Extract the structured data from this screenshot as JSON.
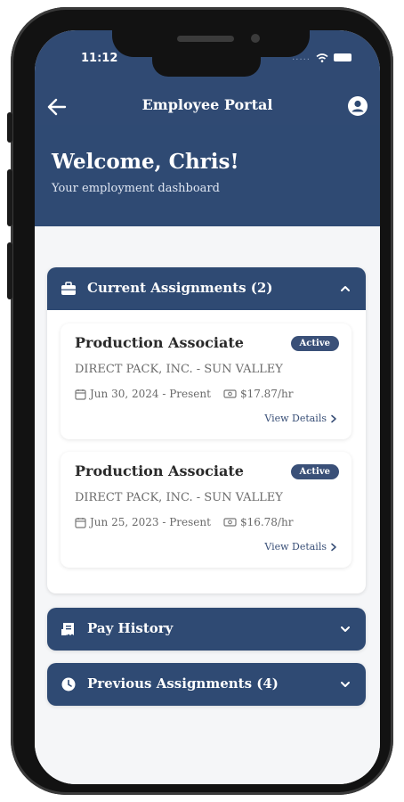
{
  "status_bar": {
    "time": "11:12",
    "signal_dots": "....."
  },
  "nav": {
    "title": "Employee Portal"
  },
  "welcome": {
    "title": "Welcome, Chris!",
    "subtitle": "Your employment dashboard"
  },
  "sections": {
    "current": {
      "title": "Current Assignments (2)",
      "assignments": [
        {
          "title": "Production Associate",
          "status": "Active",
          "company": "DIRECT PACK, INC. - SUN VALLEY",
          "dates": "Jun 30, 2024 - Present",
          "pay": "$17.87/hr",
          "link": "View Details"
        },
        {
          "title": "Production Associate",
          "status": "Active",
          "company": "DIRECT PACK, INC. - SUN VALLEY",
          "dates": "Jun 25, 2023 - Present",
          "pay": "$16.78/hr",
          "link": "View Details"
        }
      ]
    },
    "pay_history": {
      "title": "Pay History"
    },
    "previous": {
      "title": "Previous Assignments (4)"
    }
  },
  "icons": {
    "back": "arrow-left-icon",
    "profile": "user-circle-icon",
    "briefcase": "briefcase-icon",
    "receipt": "receipt-icon",
    "clock": "clock-icon",
    "calendar": "calendar-icon",
    "money": "money-icon"
  },
  "colors": {
    "primary": "#2f4a73",
    "badge": "#3a5078",
    "background": "#f5f6f8"
  }
}
